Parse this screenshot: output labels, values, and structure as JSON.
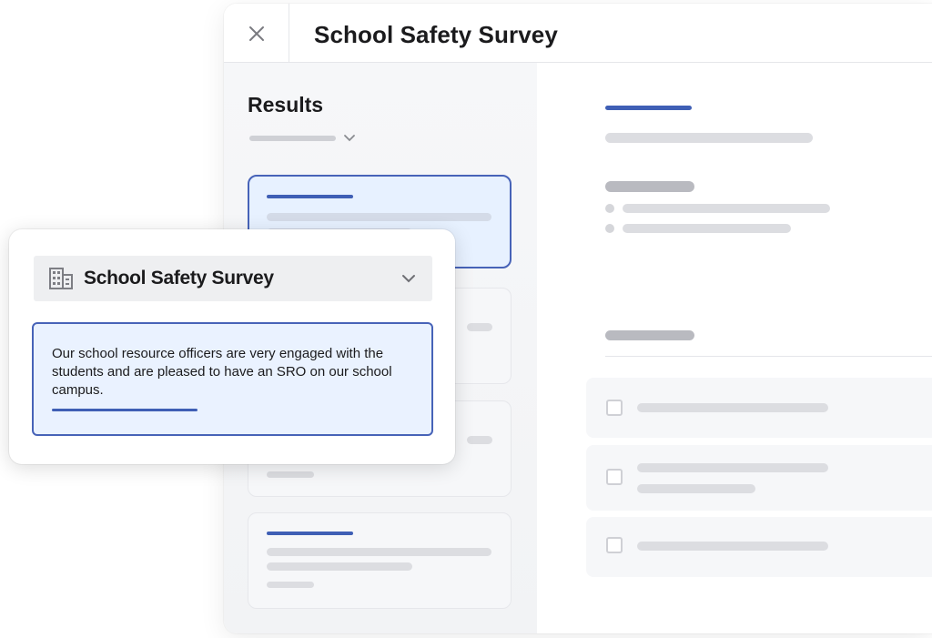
{
  "window": {
    "title": "School Safety Survey",
    "close_icon": "close-icon"
  },
  "results": {
    "title": "Results",
    "dropdown_icon": "chevron-down-icon"
  },
  "popup": {
    "survey_select": {
      "label": "School Safety Survey",
      "icon": "building-icon",
      "chevron": "chevron-down-icon"
    },
    "selected_response": "Our school resource officers are very engaged with the students and are pleased to have an SRO on our school campus."
  },
  "colors": {
    "accent": "#3f5fb5",
    "selected_bg": "#e7f1ff",
    "placeholder": "#dcdde1"
  }
}
